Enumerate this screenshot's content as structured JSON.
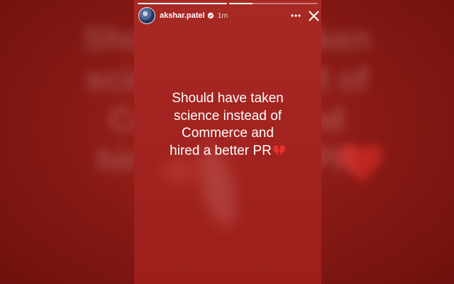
{
  "story": {
    "progress": [
      1.0,
      0.27
    ],
    "header": {
      "username": "akshar.patel",
      "time": "1m",
      "verified": true,
      "icons": {
        "verified": "verified-badge-icon",
        "more": "more-options-icon",
        "close": "close-icon"
      }
    },
    "caption": {
      "lines": [
        "Should have taken",
        "science instead of",
        "Commerce and",
        "hired a better PR"
      ],
      "emoji": "broken-heart-icon"
    }
  },
  "colors": {
    "background": "#a32420",
    "text": "#ffffff",
    "heart": "#e8302b"
  }
}
